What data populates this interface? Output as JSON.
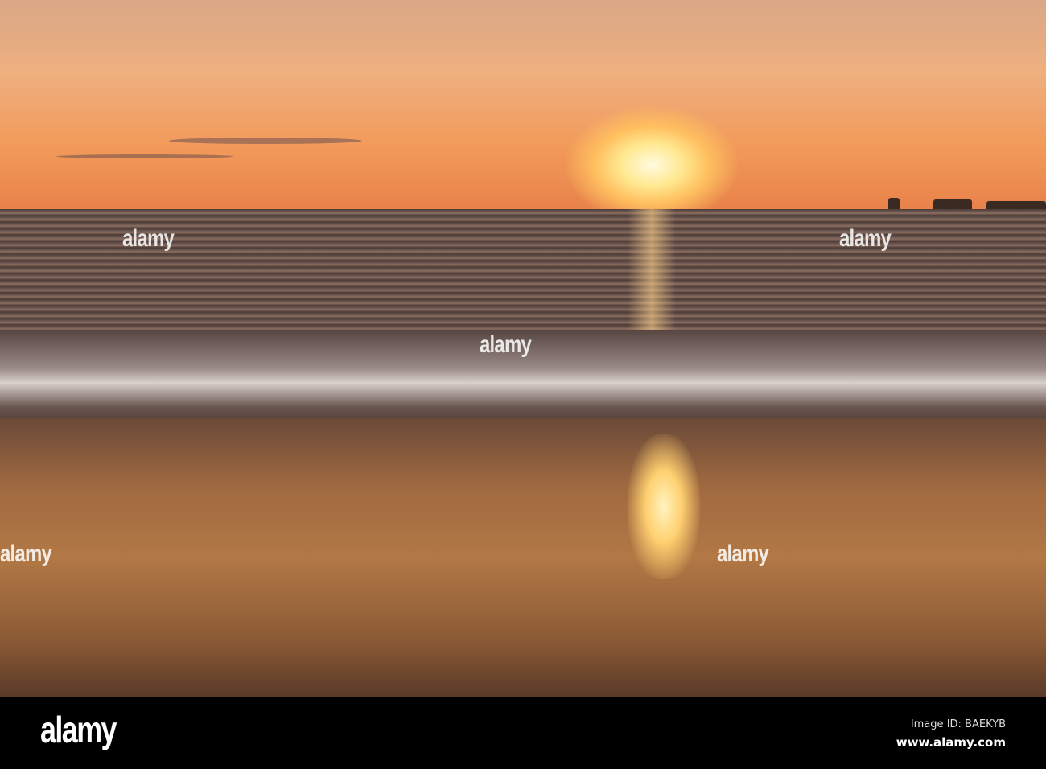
{
  "photo": {
    "description_colors": {
      "sky": "#eeb07f",
      "sun": "#fffbe0",
      "sand": "#b27845"
    }
  },
  "watermark": {
    "text": "alamy"
  },
  "footer": {
    "logo": "alamy",
    "image_id": "Image ID: BAEKYB",
    "url": "www.alamy.com"
  }
}
